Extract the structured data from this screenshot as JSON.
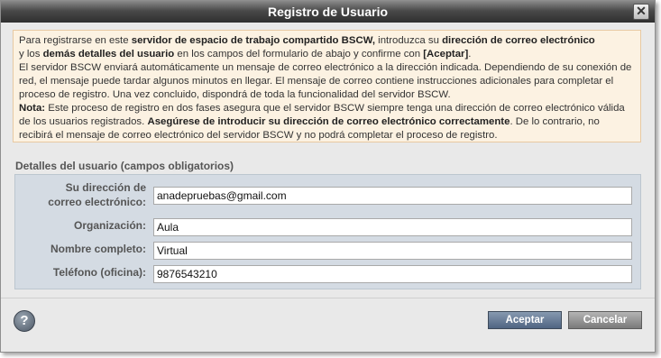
{
  "dialog": {
    "title": "Registro de Usuario",
    "close_glyph": "✕"
  },
  "info": {
    "p1_a": "Para registrarse en este ",
    "p1_b": "servidor de espacio de trabajo compartido BSCW,",
    "p1_c": " introduzca su ",
    "p1_d": "dirección de correo electrónico",
    "p1_e": " y los ",
    "p1_f": "demás detalles del usuario",
    "p1_g": " en los campos del formulario de abajo y confirme con ",
    "p1_h": "[Aceptar]",
    "p1_i": ".",
    "p2": "El servidor BSCW enviará automáticamente un mensaje de correo electrónico a la dirección indicada. Dependiendo de su conexión de red, el mensaje puede tardar algunos minutos en llegar. El mensaje de correo contiene instrucciones adicionales para completar el proceso de registro. Una vez concluido, dispondrá de toda la funcionalidad del servidor BSCW.",
    "p3_a": "Nota:",
    "p3_b": " Este proceso de registro en dos fases asegura que el servidor BSCW siempre tenga una dirección de correo electrónico válida de los usuarios registrados. ",
    "p3_c": "Asegúrese de introducir su dirección de correo electrónico correctamente",
    "p3_d": ". De lo contrario, no recibirá el mensaje de correo electrónico del servidor BSCW y no podrá completar el proceso de registro."
  },
  "form": {
    "section_title": "Detalles del usuario (campos obligatorios)",
    "email_label_1": "Su dirección de",
    "email_label_2": "correo electrónico:",
    "email_value": "anadepruebas@gmail.com",
    "org_label": "Organización:",
    "org_value": "Aula",
    "name_label": "Nombre completo:",
    "name_value": "Virtual",
    "phone_label": "Teléfono (oficina):",
    "phone_value": "9876543210"
  },
  "buttons": {
    "help_glyph": "?",
    "ok_label": "Aceptar",
    "cancel_label": "Cancelar"
  }
}
